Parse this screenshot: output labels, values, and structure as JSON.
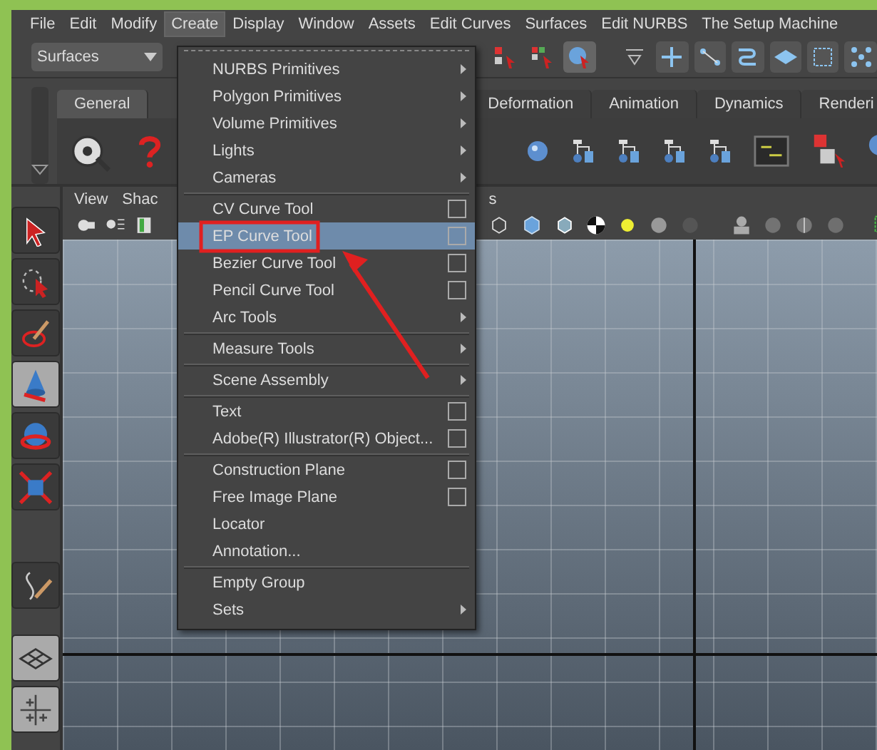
{
  "menu_bar": [
    {
      "label": "File",
      "selected": false
    },
    {
      "label": "Edit",
      "selected": false
    },
    {
      "label": "Modify",
      "selected": false
    },
    {
      "label": "Create",
      "selected": true
    },
    {
      "label": "Display",
      "selected": false
    },
    {
      "label": "Window",
      "selected": false
    },
    {
      "label": "Assets",
      "selected": false
    },
    {
      "label": "Edit Curves",
      "selected": false
    },
    {
      "label": "Surfaces",
      "selected": false
    },
    {
      "label": "Edit NURBS",
      "selected": false
    },
    {
      "label": "The Setup Machine",
      "selected": false
    }
  ],
  "status_line": {
    "menu_set": "Surfaces"
  },
  "shelf": {
    "tabs": [
      {
        "label": "General",
        "selected": true
      },
      {
        "label": "Deformation",
        "selected": false
      },
      {
        "label": "Animation",
        "selected": false
      },
      {
        "label": "Dynamics",
        "selected": false
      },
      {
        "label": "Renderi",
        "selected": false
      }
    ]
  },
  "viewport": {
    "menus": [
      "View",
      "Shac",
      "s"
    ]
  },
  "create_menu": {
    "groups": [
      [
        {
          "label": "NURBS Primitives",
          "kind": "submenu",
          "selected": false
        },
        {
          "label": "Polygon Primitives",
          "kind": "submenu",
          "selected": false
        },
        {
          "label": "Volume Primitives",
          "kind": "submenu",
          "selected": false
        },
        {
          "label": "Lights",
          "kind": "submenu",
          "selected": false
        },
        {
          "label": "Cameras",
          "kind": "submenu",
          "selected": false
        }
      ],
      [
        {
          "label": "CV Curve Tool",
          "kind": "option",
          "selected": false
        },
        {
          "label": "EP Curve Tool",
          "kind": "option",
          "selected": true
        },
        {
          "label": "Bezier Curve Tool",
          "kind": "option",
          "selected": false
        },
        {
          "label": "Pencil Curve Tool",
          "kind": "option",
          "selected": false
        },
        {
          "label": "Arc Tools",
          "kind": "submenu",
          "selected": false
        }
      ],
      [
        {
          "label": "Measure Tools",
          "kind": "submenu",
          "selected": false
        }
      ],
      [
        {
          "label": "Scene Assembly",
          "kind": "submenu",
          "selected": false
        }
      ],
      [
        {
          "label": "Text",
          "kind": "option",
          "selected": false
        },
        {
          "label": "Adobe(R) Illustrator(R) Object...",
          "kind": "option",
          "selected": false
        }
      ],
      [
        {
          "label": "Construction Plane",
          "kind": "option",
          "selected": false
        },
        {
          "label": "Free Image Plane",
          "kind": "option",
          "selected": false
        },
        {
          "label": "Locator",
          "kind": "plain",
          "selected": false
        },
        {
          "label": "Annotation...",
          "kind": "plain",
          "selected": false
        }
      ],
      [
        {
          "label": "Empty Group",
          "kind": "plain",
          "selected": false
        },
        {
          "label": "Sets",
          "kind": "submenu",
          "selected": false
        }
      ]
    ]
  }
}
